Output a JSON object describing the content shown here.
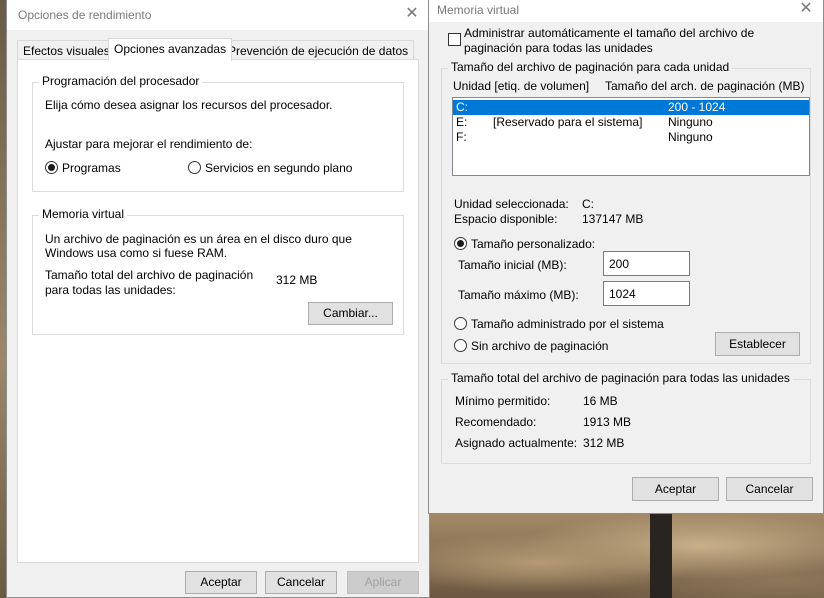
{
  "perf_window": {
    "title": "Opciones de rendimiento",
    "tabs": [
      "Efectos visuales",
      "Opciones avanzadas",
      "Prevención de ejecución de datos"
    ],
    "active_tab": "Opciones avanzadas",
    "processor": {
      "legend": "Programación del procesador",
      "description": "Elija cómo desea asignar los recursos del procesador.",
      "adjust_label": "Ajustar para mejorar el rendimiento de:",
      "option_programs": "Programas",
      "option_services": "Servicios en segundo plano",
      "selected": "Programas"
    },
    "virtual_memory": {
      "legend": "Memoria virtual",
      "description_line1": "Un archivo de paginación es un área en el disco duro que",
      "description_line2": "Windows usa como si fuese RAM.",
      "total_label_line1": "Tamaño total del archivo de paginación",
      "total_label_line2": "para todas las unidades:",
      "total_value": "312 MB",
      "change_button": "Cambiar..."
    },
    "buttons": {
      "ok": "Aceptar",
      "cancel": "Cancelar",
      "apply": "Aplicar"
    }
  },
  "vm_window": {
    "title": "Memoria virtual",
    "auto_manage_line1": "Administrar automáticamente el tamaño del archivo de",
    "auto_manage_line2": "paginación para todas las unidades",
    "auto_manage_checked": false,
    "per_drive": {
      "legend": "Tamaño del archivo de paginación para cada unidad",
      "col_drive": "Unidad [etiq. de volumen]",
      "col_size": "Tamaño del arch. de paginación (MB)",
      "rows": [
        {
          "drive": "C:",
          "label": "",
          "size": "200 - 1024",
          "selected": true
        },
        {
          "drive": "E:",
          "label": "[Reservado para el sistema]",
          "size": "Ninguno",
          "selected": false
        },
        {
          "drive": "F:",
          "label": "",
          "size": "Ninguno",
          "selected": false
        }
      ],
      "selected_drive_label": "Unidad seleccionada:",
      "selected_drive_value": "C:",
      "free_space_label": "Espacio disponible:",
      "free_space_value": "137147 MB",
      "option_custom": "Tamaño personalizado:",
      "initial_label": "Tamaño inicial (MB):",
      "initial_value": "200",
      "max_label": "Tamaño máximo (MB):",
      "max_value": "1024",
      "option_system": "Tamaño administrado por el sistema",
      "option_none": "Sin archivo de paginación",
      "selected_option": "Tamaño personalizado",
      "set_button": "Establecer"
    },
    "totals": {
      "legend": "Tamaño total del archivo de paginación para todas las unidades",
      "min_label": "Mínimo permitido:",
      "min_value": "16 MB",
      "recommended_label": "Recomendado:",
      "recommended_value": "1913 MB",
      "current_label": "Asignado actualmente:",
      "current_value": "312 MB"
    },
    "buttons": {
      "ok": "Aceptar",
      "cancel": "Cancelar"
    }
  },
  "colors": {
    "selection": "#0078d7",
    "window_bg": "#f0f0f0",
    "disabled_text": "#a0a0a0"
  },
  "icons": {
    "close": "close-icon"
  }
}
